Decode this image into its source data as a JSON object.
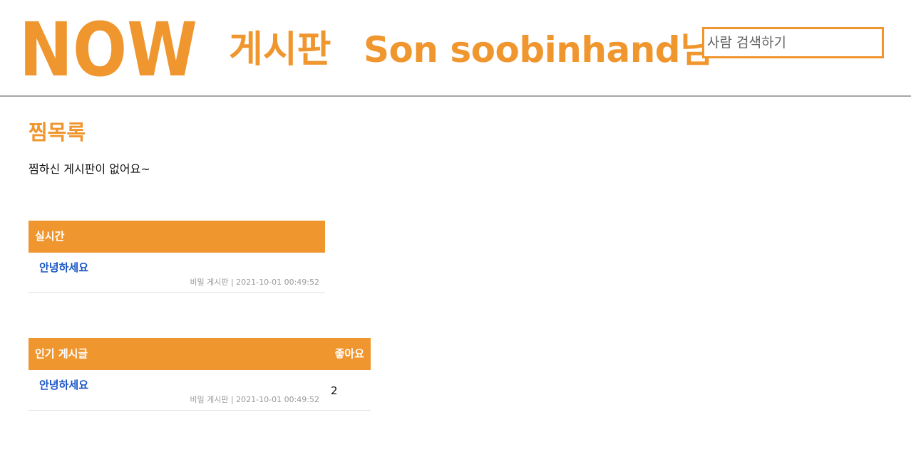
{
  "header": {
    "logo_text": "NOW",
    "board_link": "게시판",
    "user_greeting": "Son soobinhand님",
    "search_placeholder": "사람 검색하기"
  },
  "wishlist": {
    "title": "찜목록",
    "empty_message": "찜하신 게시판이 없어요~"
  },
  "realtime": {
    "title": "실시간",
    "posts": [
      {
        "title": "안녕하세요",
        "meta": "비밀 게시판 | 2021-10-01 00:49:52"
      }
    ]
  },
  "popular": {
    "title": "인기 게시글",
    "likes_header": "좋아요",
    "posts": [
      {
        "title": "안녕하세요",
        "meta": "비밀 게시판 | 2021-10-01 00:49:52",
        "likes": "2"
      }
    ]
  },
  "colors": {
    "accent": "#f0962e",
    "link": "#1a56c6",
    "meta": "#9a9a9a",
    "divider": "#a6a6a6"
  }
}
